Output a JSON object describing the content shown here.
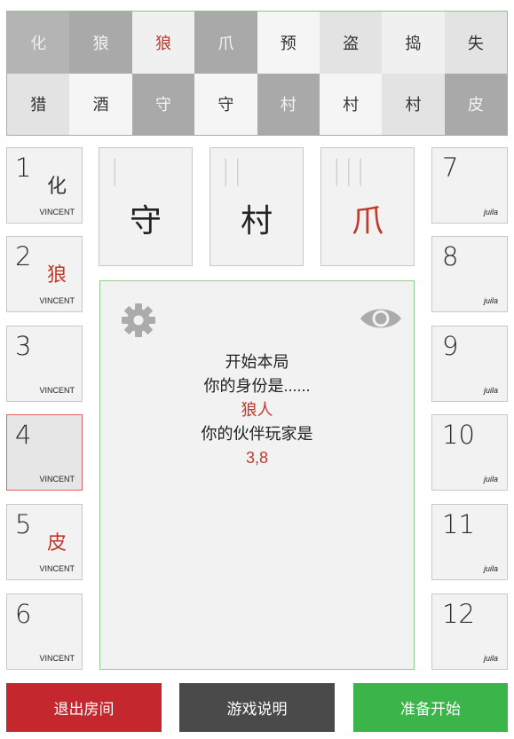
{
  "colors": {
    "accent_red": "#c0392b",
    "pool_border_green": "#83c886",
    "panel_border_green": "#8fd08f",
    "selected_border": "#e06262",
    "exit_button": "#c4282e",
    "help_button": "#4a4a4a",
    "ready_button": "#3bb54a",
    "icon_gray": "#ababab"
  },
  "role_pool": {
    "rows": [
      [
        {
          "char": "化",
          "bg": "#b4b4b4",
          "fg": "#eeeeee"
        },
        {
          "char": "狼",
          "bg": "#a9a9a9",
          "fg": "#f4f4f4"
        },
        {
          "char": "狼",
          "bg": "#f0f0f0",
          "fg": "#c0392b"
        },
        {
          "char": "爪",
          "bg": "#a9a9a9",
          "fg": "#f4f4f4"
        },
        {
          "char": "预",
          "bg": "#f5f5f5",
          "fg": "#333333"
        },
        {
          "char": "盗",
          "bg": "#e3e3e3",
          "fg": "#333333"
        },
        {
          "char": "捣",
          "bg": "#f0f0f0",
          "fg": "#333333"
        },
        {
          "char": "失",
          "bg": "#e3e3e3",
          "fg": "#333333"
        }
      ],
      [
        {
          "char": "猎",
          "bg": "#e3e3e3",
          "fg": "#333333"
        },
        {
          "char": "酒",
          "bg": "#f5f5f5",
          "fg": "#333333"
        },
        {
          "char": "守",
          "bg": "#a9a9a9",
          "fg": "#f4f4f4"
        },
        {
          "char": "守",
          "bg": "#f5f5f5",
          "fg": "#333333"
        },
        {
          "char": "村",
          "bg": "#a9a9a9",
          "fg": "#f4f4f4"
        },
        {
          "char": "村",
          "bg": "#f5f5f5",
          "fg": "#333333"
        },
        {
          "char": "村",
          "bg": "#e3e3e3",
          "fg": "#333333"
        },
        {
          "char": "皮",
          "bg": "#a9a9a9",
          "fg": "#f4f4f4"
        }
      ]
    ]
  },
  "players_left": [
    {
      "number": "1",
      "role": "化",
      "role_color": "#333333",
      "name": "VINCENT"
    },
    {
      "number": "2",
      "role": "狼",
      "role_color": "#c0392b",
      "name": "VINCENT"
    },
    {
      "number": "3",
      "name": "VINCENT"
    },
    {
      "number": "4",
      "name": "VINCENT",
      "selected": true
    },
    {
      "number": "5",
      "role": "皮",
      "role_color": "#c0392b",
      "name": "VINCENT"
    },
    {
      "number": "6",
      "name": "VINCENT"
    }
  ],
  "players_right": [
    {
      "number": "7",
      "name": "juila"
    },
    {
      "number": "8",
      "name": "juila"
    },
    {
      "number": "9",
      "name": "juila"
    },
    {
      "number": "10",
      "name": "juila"
    },
    {
      "number": "11",
      "name": "juila"
    },
    {
      "number": "12",
      "name": "juila"
    }
  ],
  "center_cards": [
    {
      "numeral": "|",
      "char": "守",
      "color": "#222222"
    },
    {
      "numeral": "||",
      "char": "村",
      "color": "#222222"
    },
    {
      "numeral": "|||",
      "char": "爪",
      "color": "#c0392b"
    }
  ],
  "icons": {
    "settings": "gear-icon",
    "visibility": "eye-icon"
  },
  "message": {
    "line1": "开始本局",
    "line2": "你的身份是......",
    "role": "狼人",
    "line4": "你的伙伴玩家是",
    "partners": "3,8"
  },
  "buttons": {
    "exit": "退出房间",
    "help": "游戏说明",
    "ready": "准备开始"
  }
}
